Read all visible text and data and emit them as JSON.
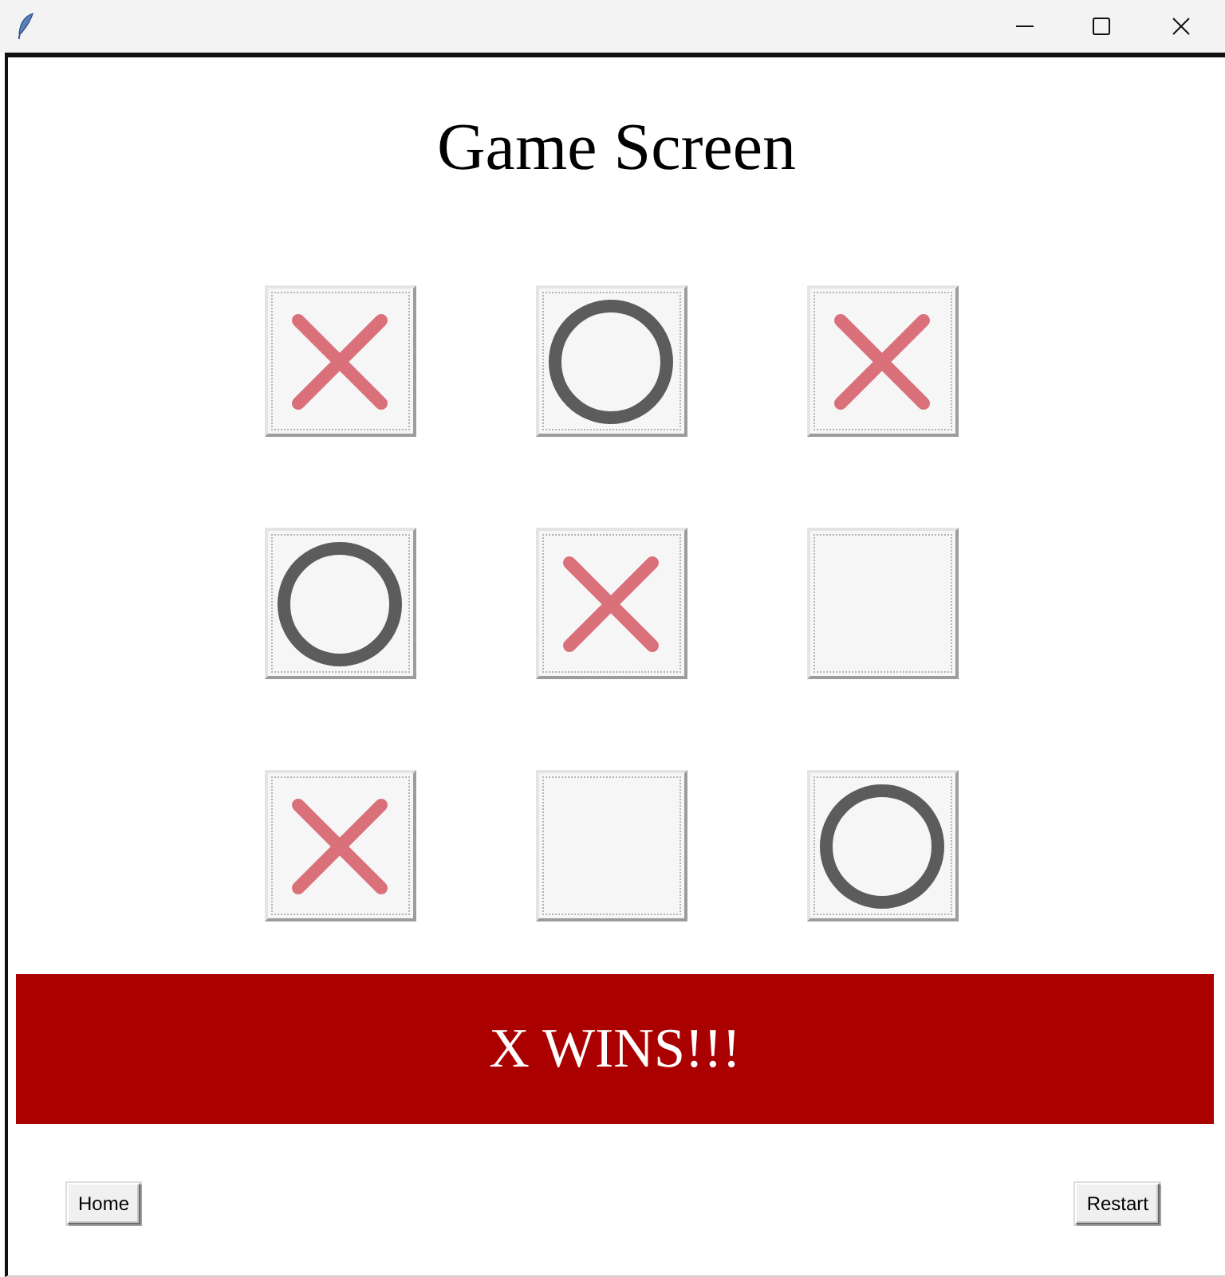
{
  "title": "Game Screen",
  "board": [
    {
      "cells": [
        {
          "kind": "x"
        },
        {
          "kind": "o"
        },
        {
          "kind": "x"
        }
      ]
    },
    {
      "cells": [
        {
          "kind": "o"
        },
        {
          "kind": "x"
        },
        {
          "kind": "empty"
        }
      ]
    },
    {
      "cells": [
        {
          "kind": "x"
        },
        {
          "kind": "empty"
        },
        {
          "kind": "o"
        }
      ]
    }
  ],
  "banner": {
    "text": "X WINS!!!"
  },
  "buttons": [
    {
      "label": "Home"
    },
    {
      "label": "Restart"
    }
  ]
}
